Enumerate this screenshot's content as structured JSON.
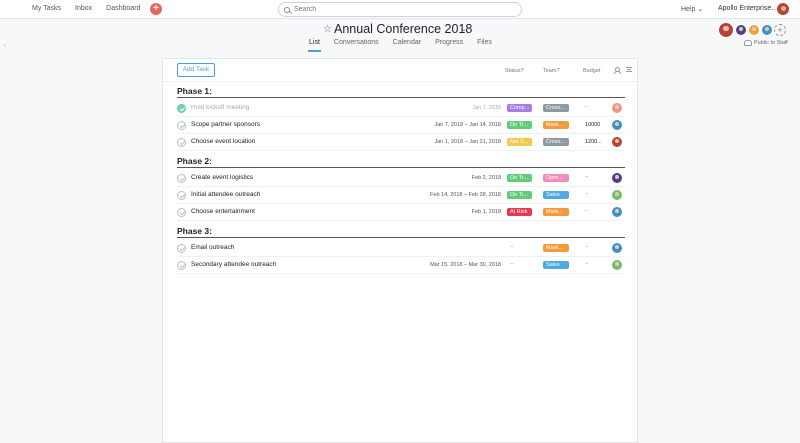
{
  "topbar": {
    "nav": [
      "My Tasks",
      "Inbox",
      "Dashboard"
    ],
    "search_placeholder": "Search",
    "help": "Help",
    "org": "Apollo Enterprise..."
  },
  "project": {
    "title": "Annual Conference 2018",
    "tabs": [
      "List",
      "Conversations",
      "Calendar",
      "Progress",
      "Files"
    ],
    "active_tab": "List",
    "public_label": "Public to Staff"
  },
  "toolbar": {
    "add_task": "Add Task",
    "col_status": "Status?",
    "col_team": "Team?",
    "col_budget": "Budget"
  },
  "colors": {
    "complete": "#a57be6",
    "on_track": "#62cc7b",
    "not_started": "#f2c94c",
    "at_risk": "#e8384f",
    "cross": "#8e9aa1",
    "marketing": "#f59a3c",
    "operations": "#f28cb8",
    "sales": "#4ca9e4",
    "accent": "#4b9ee6"
  },
  "sections": [
    {
      "title": "Phase 1:",
      "tasks": [
        {
          "name": "Hold kickoff meeting",
          "done": true,
          "date": "Jan 7, 2018",
          "status": "Comp...",
          "status_color": "#a57be6",
          "team": "Cross...",
          "team_color": "#8e9aa1",
          "budget": "",
          "avatar_color": "#e8988a"
        },
        {
          "name": "Scope partner sponsors",
          "done": false,
          "date": "Jan 7, 2018 – Jan 14, 2018",
          "status": "On Tr...",
          "status_color": "#62cc7b",
          "team": "Mark...",
          "team_color": "#f59a3c",
          "budget": "10000",
          "avatar_color": "#3f8fc9"
        },
        {
          "name": "Choose event location",
          "done": false,
          "date": "Jan 1, 2018 – Jan 21, 2018",
          "status": "Not S...",
          "status_color": "#f2c94c",
          "team": "Cross...",
          "team_color": "#8e9aa1",
          "budget": "1200...",
          "avatar_color": "#b4433b"
        }
      ]
    },
    {
      "title": "Phase 2:",
      "tasks": [
        {
          "name": "Create event logistics",
          "done": false,
          "date": "Feb 2, 2018",
          "status": "On Tr...",
          "status_color": "#62cc7b",
          "team": "Oper...",
          "team_color": "#f28cb8",
          "budget": "",
          "avatar_color": "#4b3f8c"
        },
        {
          "name": "Initial attendee outreach",
          "done": false,
          "date": "Feb 14, 2018 – Feb 28, 2018",
          "status": "On Tr...",
          "status_color": "#62cc7b",
          "team": "Sales",
          "team_color": "#4ca9e4",
          "budget": "",
          "avatar_color": "#6fbf73"
        },
        {
          "name": "Choose entertainment",
          "done": false,
          "date": "Feb 1, 2018",
          "status": "At Risk",
          "status_color": "#e8384f",
          "team": "Mark...",
          "team_color": "#f59a3c",
          "budget": "",
          "avatar_color": "#3f8fc9"
        }
      ]
    },
    {
      "title": "Phase 3:",
      "tasks": [
        {
          "name": "Email outreach",
          "done": false,
          "date": "",
          "status": "",
          "status_color": "",
          "team": "Mark...",
          "team_color": "#f59a3c",
          "budget": "",
          "avatar_color": "#3f8fc9"
        },
        {
          "name": "Secondary attendee outreach",
          "done": false,
          "date": "Mar 15, 2018 – Mar 30, 2018",
          "status": "",
          "status_color": "",
          "team": "Sales",
          "team_color": "#4ca9e4",
          "budget": "",
          "avatar_color": "#6fbf73"
        }
      ]
    }
  ],
  "empty_mark": "–"
}
